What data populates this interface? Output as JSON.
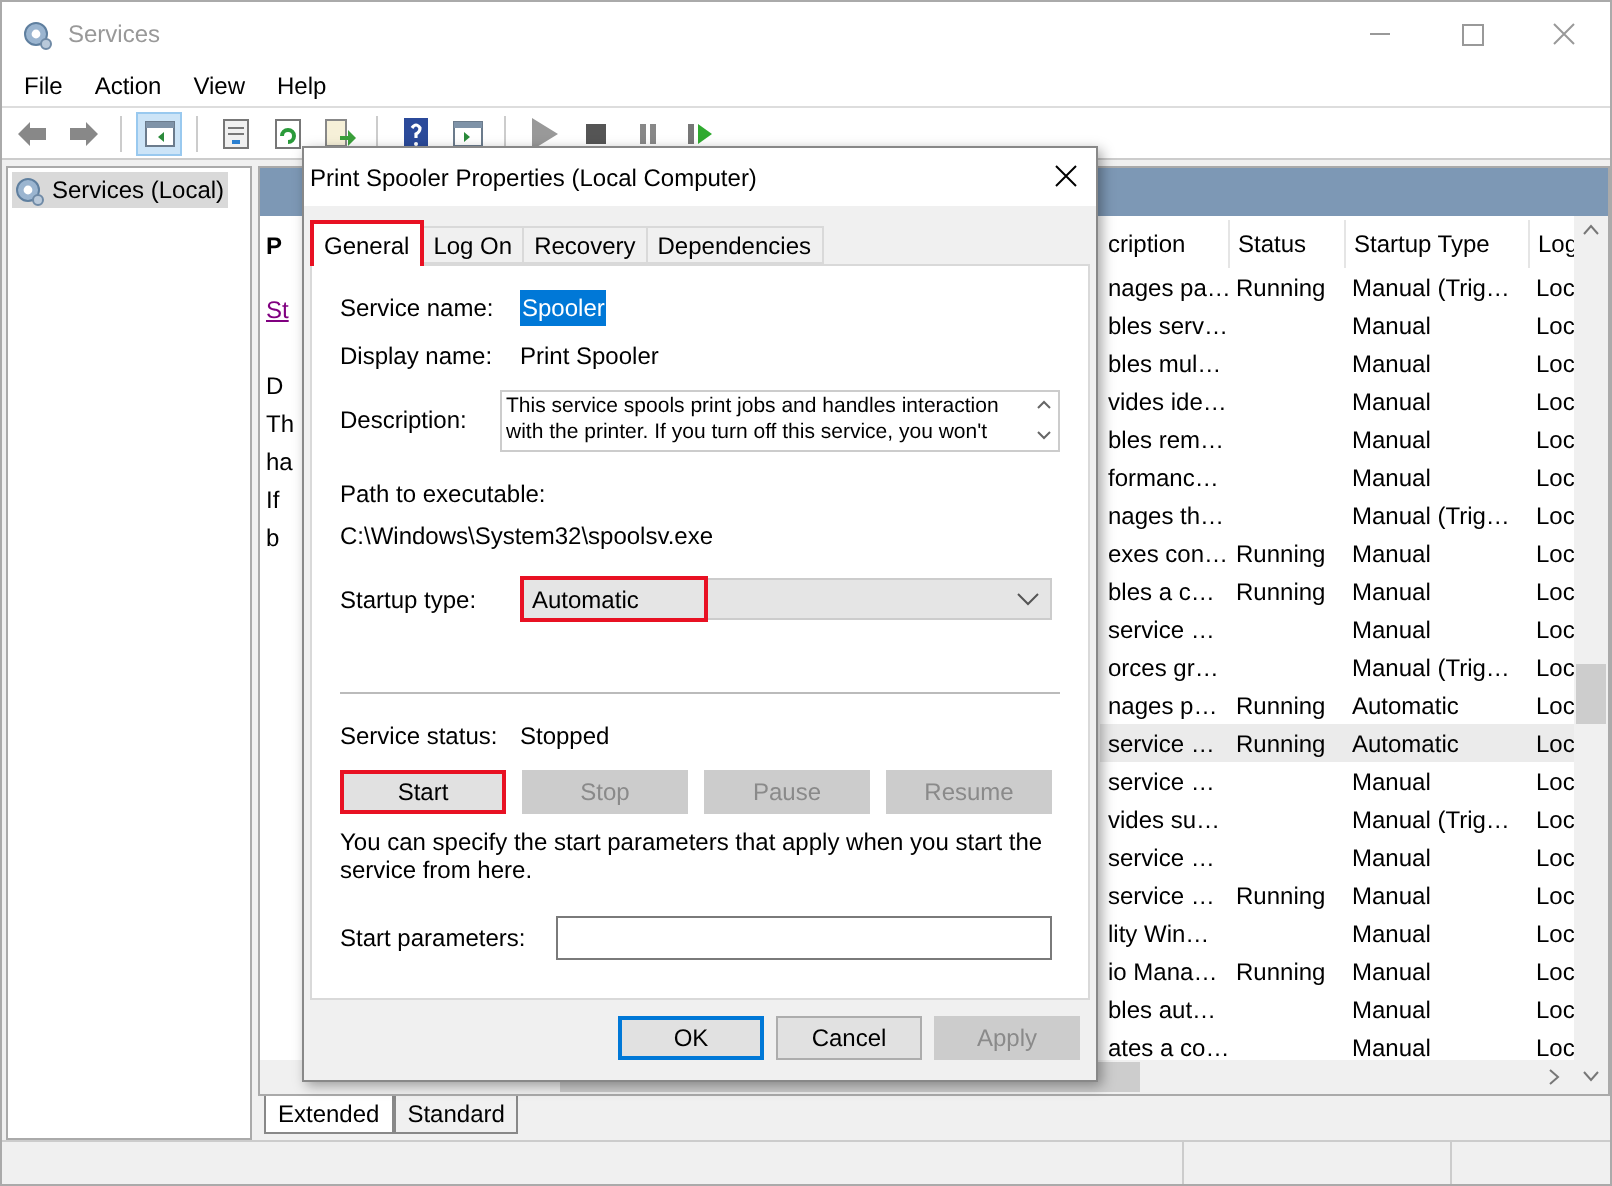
{
  "window": {
    "title": "Services"
  },
  "menu": [
    "File",
    "Action",
    "View",
    "Help"
  ],
  "toolbar": [
    {
      "kind": "back",
      "selected": false
    },
    {
      "kind": "forward",
      "selected": false
    },
    {
      "kind": "sep"
    },
    {
      "kind": "tree",
      "selected": true
    },
    {
      "kind": "sep"
    },
    {
      "kind": "properties",
      "selected": false
    },
    {
      "kind": "refresh",
      "selected": false
    },
    {
      "kind": "export",
      "selected": false
    },
    {
      "kind": "sep"
    },
    {
      "kind": "help",
      "selected": false
    },
    {
      "kind": "pane",
      "selected": false
    },
    {
      "kind": "sep"
    },
    {
      "kind": "play",
      "selected": false
    },
    {
      "kind": "stop",
      "selected": false
    },
    {
      "kind": "pause",
      "selected": false
    },
    {
      "kind": "restart",
      "selected": false
    }
  ],
  "tree": [
    {
      "label": "Services (Local)",
      "selected": true
    }
  ],
  "detail": {
    "title": "P",
    "link": "St",
    "lines": [
      "D",
      "Th",
      "ha",
      "If",
      "b"
    ]
  },
  "table": {
    "columns": [
      "cription",
      "Status",
      "Startup Type",
      "Log"
    ],
    "rows": [
      {
        "cells": [
          "nages pa…",
          "Running",
          "Manual (Trig…",
          "Loc"
        ],
        "selected": false
      },
      {
        "cells": [
          "bles serv…",
          "",
          "Manual",
          "Loc"
        ],
        "selected": false
      },
      {
        "cells": [
          "bles mul…",
          "",
          "Manual",
          "Loc"
        ],
        "selected": false
      },
      {
        "cells": [
          "vides ide…",
          "",
          "Manual",
          "Loc"
        ],
        "selected": false
      },
      {
        "cells": [
          "bles rem…",
          "",
          "Manual",
          "Loc"
        ],
        "selected": false
      },
      {
        "cells": [
          "formanc…",
          "",
          "Manual",
          "Loc"
        ],
        "selected": false
      },
      {
        "cells": [
          "nages th…",
          "",
          "Manual (Trig…",
          "Loc"
        ],
        "selected": false
      },
      {
        "cells": [
          "exes con…",
          "Running",
          "Manual",
          "Loc"
        ],
        "selected": false
      },
      {
        "cells": [
          "bles a c…",
          "Running",
          "Manual",
          "Loc"
        ],
        "selected": false
      },
      {
        "cells": [
          "service …",
          "",
          "Manual",
          "Loc"
        ],
        "selected": false
      },
      {
        "cells": [
          "orces gr…",
          "",
          "Manual (Trig…",
          "Loc"
        ],
        "selected": false
      },
      {
        "cells": [
          "nages p…",
          "Running",
          "Automatic",
          "Loc"
        ],
        "selected": false
      },
      {
        "cells": [
          "service …",
          "Running",
          "Automatic",
          "Loc"
        ],
        "selected": true
      },
      {
        "cells": [
          "service …",
          "",
          "Manual",
          "Loc"
        ],
        "selected": false
      },
      {
        "cells": [
          "vides su…",
          "",
          "Manual (Trig…",
          "Loc"
        ],
        "selected": false
      },
      {
        "cells": [
          "service …",
          "",
          "Manual",
          "Loc"
        ],
        "selected": false
      },
      {
        "cells": [
          "service …",
          "Running",
          "Manual",
          "Loc"
        ],
        "selected": false
      },
      {
        "cells": [
          "lity Win…",
          "",
          "Manual",
          "Loc"
        ],
        "selected": false
      },
      {
        "cells": [
          "io Mana…",
          "Running",
          "Manual",
          "Loc"
        ],
        "selected": false
      },
      {
        "cells": [
          "bles aut…",
          "",
          "Manual",
          "Loc"
        ],
        "selected": false
      },
      {
        "cells": [
          "ates a co…",
          "",
          "Manual",
          "Loc"
        ],
        "selected": false
      }
    ]
  },
  "view_tabs": [
    {
      "label": "Extended",
      "selected": true
    },
    {
      "label": "Standard",
      "selected": false
    }
  ],
  "dialog": {
    "title": "Print Spooler Properties (Local Computer)",
    "tabs": [
      {
        "label": "General",
        "selected": true,
        "highlighted": true
      },
      {
        "label": "Log On",
        "selected": false,
        "highlighted": false
      },
      {
        "label": "Recovery",
        "selected": false,
        "highlighted": false
      },
      {
        "label": "Dependencies",
        "selected": false,
        "highlighted": false
      }
    ],
    "service_name": {
      "label": "Service name:",
      "value": "Spooler"
    },
    "display_name": {
      "label": "Display name:",
      "value": "Print Spooler"
    },
    "description": {
      "label": "Description:",
      "value": "This service spools print jobs and handles interaction with the printer.  If you turn off this service, you won't"
    },
    "path": {
      "label": "Path to executable:",
      "value": "C:\\Windows\\System32\\spoolsv.exe"
    },
    "startup_type": {
      "label": "Startup type:",
      "value": "Automatic",
      "highlighted": true
    },
    "service_status": {
      "label": "Service status:",
      "value": "Stopped"
    },
    "service_buttons": [
      {
        "label": "Start",
        "disabled": false,
        "highlighted": true
      },
      {
        "label": "Stop",
        "disabled": true,
        "highlighted": false
      },
      {
        "label": "Pause",
        "disabled": true,
        "highlighted": false
      },
      {
        "label": "Resume",
        "disabled": true,
        "highlighted": false
      }
    ],
    "hint": "You can specify the start parameters that apply when you start the service from here.",
    "start_parameters": {
      "label": "Start parameters:"
    },
    "buttons": [
      {
        "label": "OK",
        "disabled": false,
        "default": true
      },
      {
        "label": "Cancel",
        "disabled": false,
        "default": false
      },
      {
        "label": "Apply",
        "disabled": true,
        "default": false
      }
    ]
  }
}
